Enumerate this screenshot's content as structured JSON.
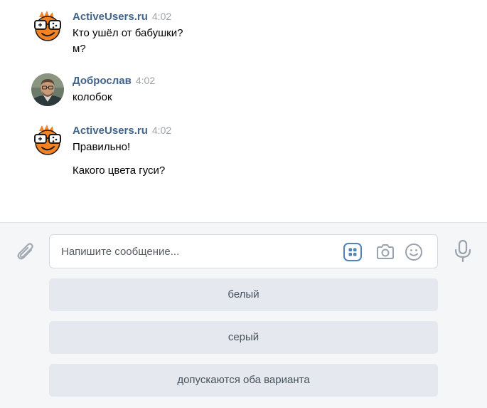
{
  "messages": [
    {
      "author": "ActiveUsers.ru",
      "time": "4:02",
      "avatar": "activeusers-logo",
      "lines": [
        "Кто ушёл от бабушки?",
        "м?"
      ]
    },
    {
      "author": "Доброслав",
      "time": "4:02",
      "avatar": "user-photo",
      "lines": [
        "колобок"
      ]
    },
    {
      "author": "ActiveUsers.ru",
      "time": "4:02",
      "avatar": "activeusers-logo",
      "lines": [
        "Правильно!",
        "Какого цвета гуси?"
      ]
    }
  ],
  "composer": {
    "placeholder": "Напишите сообщение...",
    "icons": [
      "paperclip-icon",
      "bot-keyboard-icon",
      "camera-icon",
      "emoji-icon",
      "microphone-icon"
    ]
  },
  "keyboard": {
    "buttons": [
      "белый",
      "серый",
      "допускаются оба варианта"
    ]
  },
  "colors": {
    "author": "#42648b",
    "time": "#a0a4a8",
    "composer_bg": "#f5f6f8",
    "button_bg": "#e5e9ef",
    "button_text": "#47525e",
    "keyboard_icon": "#5181b8",
    "logo_orange": "#f58220"
  }
}
